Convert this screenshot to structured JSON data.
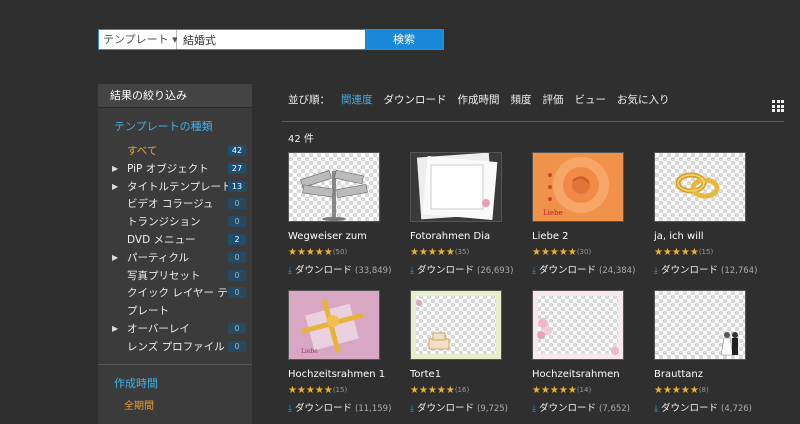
{
  "search": {
    "category": "テンプレート ▾",
    "query": "結婚式",
    "button": "検索"
  },
  "sidebar": {
    "header": "結果の絞り込み",
    "section_type": "テンプレートの種類",
    "items": [
      {
        "label": "すべて",
        "count": "42",
        "arrow": "",
        "active": true,
        "zero": false
      },
      {
        "label": "PiP オブジェクト",
        "count": "27",
        "arrow": "▶",
        "zero": false
      },
      {
        "label": "タイトルテンプレート",
        "count": "13",
        "arrow": "▶",
        "zero": false
      },
      {
        "label": "ビデオ コラージュ",
        "count": "0",
        "arrow": "",
        "zero": true
      },
      {
        "label": "トランジション",
        "count": "0",
        "arrow": "",
        "zero": true
      },
      {
        "label": "DVD メニュー",
        "count": "2",
        "arrow": "",
        "zero": false
      },
      {
        "label": "パーティクル",
        "count": "0",
        "arrow": "▶",
        "zero": true
      },
      {
        "label": "写真プリセット",
        "count": "0",
        "arrow": "",
        "zero": true
      },
      {
        "label": "クイック レイヤー テン",
        "count": "0",
        "arrow": "",
        "zero": true
      },
      {
        "label": "プレート",
        "count": "",
        "arrow": "",
        "zero": true
      },
      {
        "label": "オーバーレイ",
        "count": "0",
        "arrow": "▶",
        "zero": true
      },
      {
        "label": "レンズ プロファイル",
        "count": "0",
        "arrow": "",
        "zero": true
      }
    ],
    "section_time": "作成時間",
    "period": "全期間"
  },
  "sort": {
    "label": "並び順：",
    "options": [
      "関連度",
      "ダウンロード",
      "作成時間",
      "頻度",
      "評価",
      "ビュー",
      "お気に入り"
    ],
    "active": 0
  },
  "results": {
    "count": "42 件"
  },
  "download_label": "ダウンロード",
  "cards": [
    {
      "title": "Wegweiser zum",
      "rating": "(50)",
      "downloads": "(33,849)"
    },
    {
      "title": "Fotorahmen Dia",
      "rating": "(35)",
      "downloads": "(26,693)"
    },
    {
      "title": "Liebe 2",
      "rating": "(30)",
      "downloads": "(24,384)"
    },
    {
      "title": "ja, ich will",
      "rating": "(15)",
      "downloads": "(12,764)"
    },
    {
      "title": "Hochzeitsrahmen 1",
      "rating": "(15)",
      "downloads": "(11,159)"
    },
    {
      "title": "Torte1",
      "rating": "(16)",
      "downloads": "(9,725)"
    },
    {
      "title": "Hochzeitsrahmen",
      "rating": "(14)",
      "downloads": "(7,652)"
    },
    {
      "title": "Brauttanz",
      "rating": "(8)",
      "downloads": "(4,726)"
    }
  ],
  "colors": {
    "accent": "#3fb0ec",
    "button": "#1a88d8",
    "active_item": "#e8a23a",
    "star": "#f0b02c"
  }
}
